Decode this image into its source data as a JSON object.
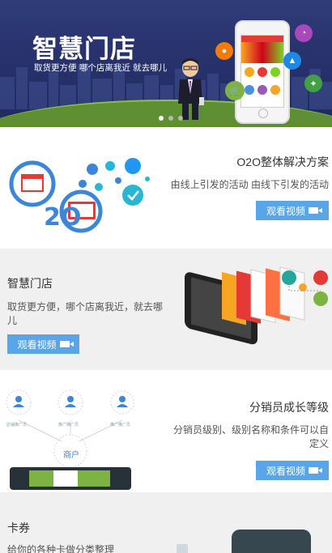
{
  "banner": {
    "title": "智慧门店",
    "subtitle": "取货更方便   哪个店离我近   就去哪儿"
  },
  "sections": [
    {
      "title": "O2O整体解决方案",
      "desc": "由线上引发的活动 由线下引发的活动",
      "button": "观看视频",
      "badge": "2O",
      "badge_prefix": "O"
    },
    {
      "title": "智慧门店",
      "desc": "取货更方便，哪个店离我近，就去哪儿",
      "button": "观看视频"
    },
    {
      "title": "分销员成长等级",
      "desc": "分销员级别、级别名称和条件可以自定义",
      "button": "观看视频",
      "diagram": {
        "nodes": [
          "店铺推广员",
          "推广推广员",
          "推广推广员"
        ],
        "center": "商户"
      }
    },
    {
      "title": "卡券",
      "desc": "给你的各种卡做分类整理"
    }
  ],
  "colors": {
    "accent": "#5aa5e8",
    "banner_bg": "#26306a",
    "ground": "#8bc34a"
  }
}
